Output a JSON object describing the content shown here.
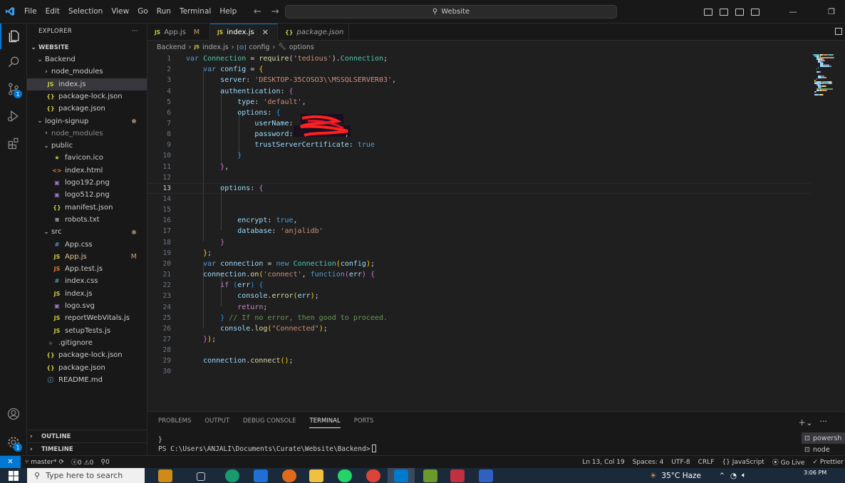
{
  "titlebar": {
    "menu": [
      "File",
      "Edit",
      "Selection",
      "View",
      "Go",
      "Run",
      "Terminal",
      "Help"
    ],
    "command_center": "Website"
  },
  "sidebar": {
    "title": "EXPLORER",
    "more": "···",
    "root": "WEBSITE",
    "items": [
      {
        "label": "Backend",
        "type": "folder-open",
        "indent": 1
      },
      {
        "label": "node_modules",
        "type": "folder",
        "indent": 2
      },
      {
        "label": "index.js",
        "type": "js",
        "indent": 2,
        "selected": true
      },
      {
        "label": "package-lock.json",
        "type": "json",
        "indent": 2
      },
      {
        "label": "package.json",
        "type": "json",
        "indent": 2
      },
      {
        "label": "login-signup",
        "type": "folder-open",
        "indent": 1,
        "dot": true
      },
      {
        "label": "node_modules",
        "type": "folder",
        "indent": 2,
        "dim": true
      },
      {
        "label": "public",
        "type": "folder-open",
        "indent": 2
      },
      {
        "label": "favicon.ico",
        "type": "star",
        "indent": 3
      },
      {
        "label": "index.html",
        "type": "html",
        "indent": 3
      },
      {
        "label": "logo192.png",
        "type": "img",
        "indent": 3
      },
      {
        "label": "logo512.png",
        "type": "img",
        "indent": 3
      },
      {
        "label": "manifest.json",
        "type": "json",
        "indent": 3
      },
      {
        "label": "robots.txt",
        "type": "txt",
        "indent": 3
      },
      {
        "label": "src",
        "type": "folder-open",
        "indent": 2,
        "dot": true
      },
      {
        "label": "App.css",
        "type": "css",
        "indent": 3
      },
      {
        "label": "App.js",
        "type": "js",
        "indent": 3,
        "modified": "M",
        "mod_color": true
      },
      {
        "label": "App.test.js",
        "type": "test",
        "indent": 3
      },
      {
        "label": "index.css",
        "type": "css",
        "indent": 3
      },
      {
        "label": "index.js",
        "type": "js",
        "indent": 3
      },
      {
        "label": "logo.svg",
        "type": "img",
        "indent": 3
      },
      {
        "label": "reportWebVitals.js",
        "type": "js",
        "indent": 3
      },
      {
        "label": "setupTests.js",
        "type": "js",
        "indent": 3
      },
      {
        "label": ".gitignore",
        "type": "git",
        "indent": 2
      },
      {
        "label": "package-lock.json",
        "type": "json",
        "indent": 2
      },
      {
        "label": "package.json",
        "type": "json",
        "indent": 2
      },
      {
        "label": "README.md",
        "type": "info",
        "indent": 2
      }
    ],
    "sections": [
      "OUTLINE",
      "TIMELINE"
    ]
  },
  "tabs": [
    {
      "icon": "JS",
      "label": "App.js",
      "modified": "M"
    },
    {
      "icon": "JS",
      "label": "index.js",
      "active": true,
      "close": "✕"
    },
    {
      "icon": "{}",
      "label": "package.json",
      "italic": true
    }
  ],
  "breadcrumb": [
    "Backend",
    "index.js",
    "config",
    "options"
  ],
  "code": [
    [
      [
        "kw",
        "var "
      ],
      [
        "cls",
        "Connection"
      ],
      [
        "pun",
        " = "
      ],
      [
        "fn",
        "require"
      ],
      [
        "pun",
        "("
      ],
      [
        "str",
        "'tedious'"
      ],
      [
        "pun",
        ")."
      ],
      [
        "cls",
        "Connection"
      ],
      [
        "pun",
        ";"
      ]
    ],
    [
      [
        "pun",
        "    "
      ],
      [
        "kw",
        "var "
      ],
      [
        "var",
        "config"
      ],
      [
        "pun",
        " = "
      ],
      [
        "br1",
        "{"
      ]
    ],
    [
      [
        "pun",
        "        "
      ],
      [
        "var",
        "server"
      ],
      [
        "pun",
        ": "
      ],
      [
        "str",
        "'DESKTOP-35COSO3\\\\MSSQLSERVER03'"
      ],
      [
        "pun",
        ","
      ]
    ],
    [
      [
        "pun",
        "        "
      ],
      [
        "var",
        "authentication"
      ],
      [
        "pun",
        ": "
      ],
      [
        "br2",
        "{"
      ]
    ],
    [
      [
        "pun",
        "            "
      ],
      [
        "var",
        "type"
      ],
      [
        "pun",
        ": "
      ],
      [
        "str",
        "'default'"
      ],
      [
        "pun",
        ","
      ]
    ],
    [
      [
        "pun",
        "            "
      ],
      [
        "var",
        "options"
      ],
      [
        "pun",
        ": "
      ],
      [
        "br3",
        "{"
      ]
    ],
    [
      [
        "pun",
        "                "
      ],
      [
        "var",
        "userName"
      ],
      [
        "pun",
        ":"
      ]
    ],
    [
      [
        "pun",
        "                "
      ],
      [
        "var",
        "password"
      ],
      [
        "pun",
        ":            ,"
      ]
    ],
    [
      [
        "pun",
        "                "
      ],
      [
        "var",
        "trustServerCertificate"
      ],
      [
        "pun",
        ": "
      ],
      [
        "kw",
        "true"
      ]
    ],
    [
      [
        "pun",
        "            "
      ],
      [
        "br3",
        "}"
      ]
    ],
    [
      [
        "pun",
        "        "
      ],
      [
        "br2",
        "}"
      ],
      [
        "pun",
        ","
      ]
    ],
    [],
    [
      [
        "pun",
        "        "
      ],
      [
        "var",
        "options"
      ],
      [
        "pun",
        ": "
      ],
      [
        "br2",
        "{"
      ]
    ],
    [],
    [],
    [
      [
        "pun",
        "            "
      ],
      [
        "var",
        "encrypt"
      ],
      [
        "pun",
        ": "
      ],
      [
        "kw",
        "true"
      ],
      [
        "pun",
        ","
      ]
    ],
    [
      [
        "pun",
        "            "
      ],
      [
        "var",
        "database"
      ],
      [
        "pun",
        ": "
      ],
      [
        "str",
        "'anjalidb'"
      ]
    ],
    [
      [
        "pun",
        "        "
      ],
      [
        "br2",
        "}"
      ]
    ],
    [
      [
        "pun",
        "    "
      ],
      [
        "br1",
        "}"
      ],
      [
        "pun",
        ";"
      ]
    ],
    [
      [
        "pun",
        "    "
      ],
      [
        "kw",
        "var "
      ],
      [
        "var",
        "connection"
      ],
      [
        "pun",
        " = "
      ],
      [
        "kw",
        "new "
      ],
      [
        "cls",
        "Connection"
      ],
      [
        "br1",
        "("
      ],
      [
        "var",
        "config"
      ],
      [
        "br1",
        ")"
      ],
      [
        "pun",
        ";"
      ]
    ],
    [
      [
        "pun",
        "    "
      ],
      [
        "var",
        "connection"
      ],
      [
        "pun",
        "."
      ],
      [
        "fn",
        "on"
      ],
      [
        "br1",
        "("
      ],
      [
        "str",
        "'connect'"
      ],
      [
        "pun",
        ", "
      ],
      [
        "kw",
        "function"
      ],
      [
        "br2",
        "("
      ],
      [
        "var",
        "err"
      ],
      [
        "br2",
        ")"
      ],
      [
        "pun",
        " "
      ],
      [
        "br2",
        "{"
      ]
    ],
    [
      [
        "pun",
        "        "
      ],
      [
        "kw2",
        "if "
      ],
      [
        "br3",
        "("
      ],
      [
        "var",
        "err"
      ],
      [
        "br3",
        ")"
      ],
      [
        "pun",
        " "
      ],
      [
        "br3",
        "{"
      ]
    ],
    [
      [
        "pun",
        "            "
      ],
      [
        "var",
        "console"
      ],
      [
        "pun",
        "."
      ],
      [
        "fn",
        "error"
      ],
      [
        "br1",
        "("
      ],
      [
        "var",
        "err"
      ],
      [
        "br1",
        ")"
      ],
      [
        "pun",
        ";"
      ]
    ],
    [
      [
        "pun",
        "            "
      ],
      [
        "kw2",
        "return"
      ],
      [
        "pun",
        ";"
      ]
    ],
    [
      [
        "pun",
        "        "
      ],
      [
        "br3",
        "}"
      ],
      [
        "cmt",
        " // If no error, then good to proceed."
      ]
    ],
    [
      [
        "pun",
        "        "
      ],
      [
        "var",
        "console"
      ],
      [
        "pun",
        "."
      ],
      [
        "fn",
        "log"
      ],
      [
        "br1",
        "("
      ],
      [
        "str",
        "\"Connected\""
      ],
      [
        "br1",
        ")"
      ],
      [
        "pun",
        ";"
      ]
    ],
    [
      [
        "pun",
        "    "
      ],
      [
        "br2",
        "}"
      ],
      [
        "br1",
        ")"
      ],
      [
        "pun",
        ";"
      ]
    ],
    [],
    [
      [
        "pun",
        "    "
      ],
      [
        "var",
        "connection"
      ],
      [
        "pun",
        "."
      ],
      [
        "fn",
        "connect"
      ],
      [
        "br1",
        "()"
      ],
      [
        "pun",
        ";"
      ]
    ],
    []
  ],
  "current_line": 13,
  "panel": {
    "tabs": [
      "PROBLEMS",
      "OUTPUT",
      "DEBUG CONSOLE",
      "TERMINAL",
      "PORTS"
    ],
    "active_tab": "TERMINAL",
    "terminal_lines": [
      "}",
      "PS C:\\Users\\ANJALI\\Documents\\Curate\\Website\\Backend>"
    ],
    "terminals": [
      "powersh",
      "node"
    ]
  },
  "statusbar": {
    "branch": "master*",
    "errors": "0",
    "warnings": "0",
    "ports": "0",
    "position": "Ln 13, Col 19",
    "spaces": "Spaces: 4",
    "encoding": "UTF-8",
    "eol": "CRLF",
    "language": "JavaScript",
    "golive": "Go Live",
    "prettier": "Prettier"
  },
  "taskbar": {
    "search_placeholder": "Type here to search",
    "weather": "35°C  Haze",
    "time": "3:06 PM"
  },
  "colors": {
    "accent": "#0078d4",
    "editor_bg": "#1f1f1f",
    "sidebar_bg": "#181818"
  }
}
